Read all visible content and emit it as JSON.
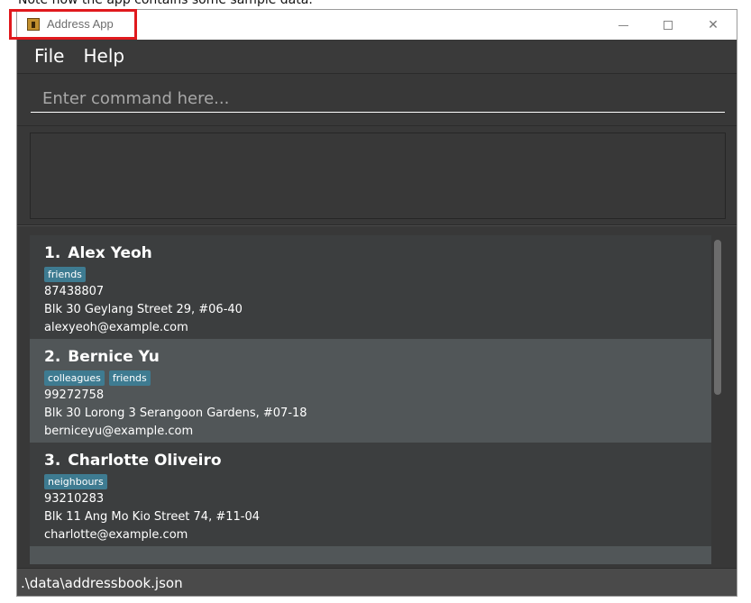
{
  "caption": "Note how the app contains some sample data.",
  "window": {
    "title": "Address App",
    "controls": {
      "minimize_icon": "minimize-icon",
      "maximize_icon": "maximize-icon",
      "close_icon": "close-icon"
    }
  },
  "menu": {
    "items": [
      "File",
      "Help"
    ]
  },
  "command": {
    "placeholder": "Enter command here...",
    "value": ""
  },
  "result": {
    "text": ""
  },
  "persons": [
    {
      "index": "1.",
      "name": "Alex Yeoh",
      "tags": [
        "friends"
      ],
      "phone": "87438807",
      "address": "Blk 30 Geylang Street 29, #06-40",
      "email": "alexyeoh@example.com"
    },
    {
      "index": "2.",
      "name": "Bernice Yu",
      "tags": [
        "colleagues",
        "friends"
      ],
      "phone": "99272758",
      "address": "Blk 30 Lorong 3 Serangoon Gardens, #07-18",
      "email": "berniceyu@example.com"
    },
    {
      "index": "3.",
      "name": "Charlotte Oliveiro",
      "tags": [
        "neighbours"
      ],
      "phone": "93210283",
      "address": "Blk 11 Ang Mo Kio Street 74, #11-04",
      "email": "charlotte@example.com"
    }
  ],
  "status": {
    "file_path": ".\\data\\addressbook.json"
  },
  "colors": {
    "window_bg": "#383838",
    "card_odd": "#3c3e3f",
    "card_even": "#515658",
    "tag_bg": "#3e7b91",
    "highlight_border": "#e0191d"
  }
}
